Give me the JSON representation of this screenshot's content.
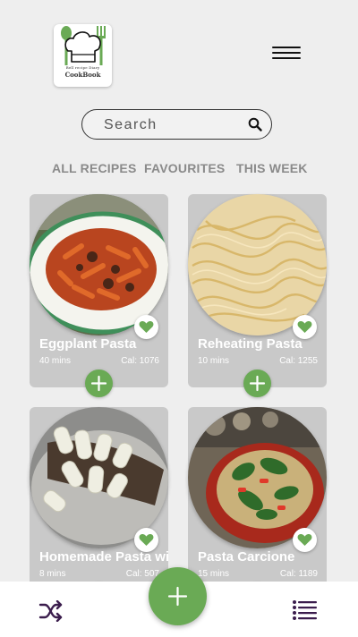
{
  "header": {
    "logo_subtitle": "Bell recipe Diary",
    "logo_title": "CookBook"
  },
  "search": {
    "placeholder": "Search"
  },
  "tabs": [
    {
      "label": "ALL RECIPES"
    },
    {
      "label": "FAVOURITES"
    },
    {
      "label": "THIS WEEK"
    }
  ],
  "recipes": [
    {
      "title": "Eggplant Pasta",
      "time": "40 mins",
      "calories": "Cal: 1076",
      "favourite": true,
      "image": "penne-with-eggplant-sauce"
    },
    {
      "title": "Reheating Pasta",
      "time": "10 mins",
      "calories": "Cal: 1255",
      "favourite": true,
      "image": "plain-spaghetti"
    },
    {
      "title": "Homemade Pasta with Macaroni",
      "time": "8 mins",
      "calories": "Cal: 507",
      "favourite": true,
      "image": "macaroni-on-wooden-spoon"
    },
    {
      "title": "Pasta Carcione",
      "time": "15 mins",
      "calories": "Cal: 1189",
      "favourite": true,
      "image": "pasta-salad-in-bowl"
    }
  ],
  "icons": {
    "logo": "chef-hat-icon",
    "menu": "hamburger-menu-icon",
    "search": "search-icon",
    "favourite": "heart-icon",
    "add": "plus-icon",
    "shuffle": "shuffle-icon",
    "list": "list-icon"
  },
  "colors": {
    "accent_green": "#6aaa55",
    "background": "#eeeeee",
    "card": "#c9c9c9",
    "tab_text": "#8a8a8a",
    "icon_dark": "#3b1d4d"
  }
}
